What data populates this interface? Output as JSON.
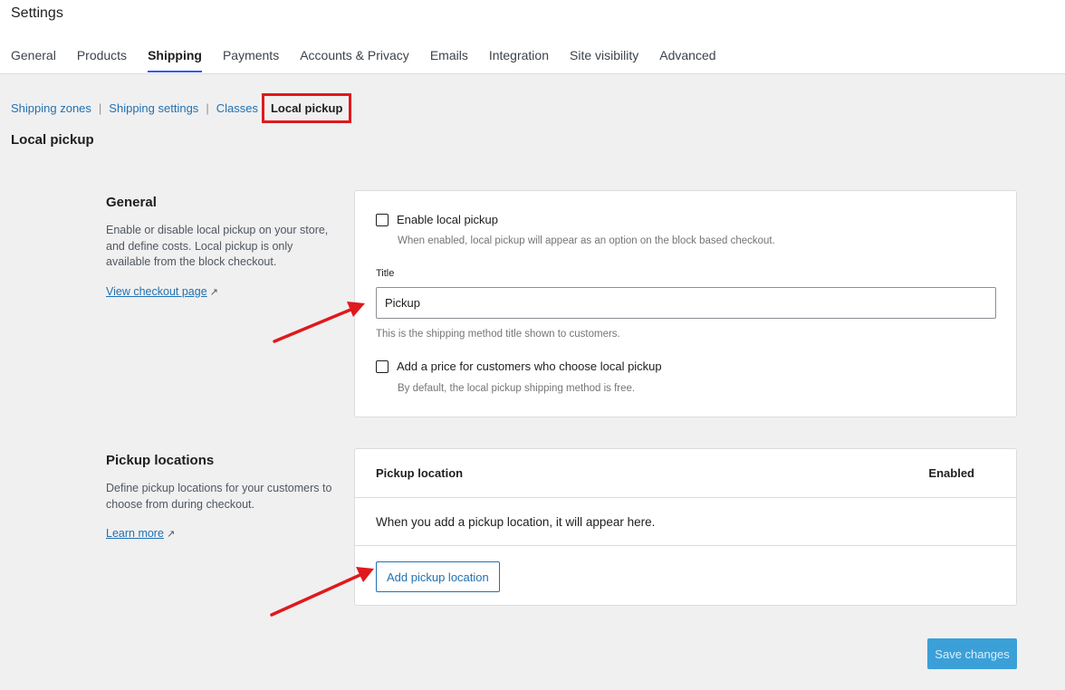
{
  "header": {
    "title": "Settings",
    "tabs": [
      {
        "label": "General"
      },
      {
        "label": "Products"
      },
      {
        "label": "Shipping",
        "active": true
      },
      {
        "label": "Payments"
      },
      {
        "label": "Accounts & Privacy"
      },
      {
        "label": "Emails"
      },
      {
        "label": "Integration"
      },
      {
        "label": "Site visibility"
      },
      {
        "label": "Advanced"
      }
    ]
  },
  "subnav": {
    "items": [
      "Shipping zones",
      "Shipping settings",
      "Classes"
    ],
    "separator": "|",
    "current": "Local pickup"
  },
  "section_title": "Local pickup",
  "general": {
    "heading": "General",
    "description": "Enable or disable local pickup on your store, and define costs. Local pickup is only available from the block checkout.",
    "link": "View checkout page",
    "link_icon": "↗",
    "enable": {
      "label": "Enable local pickup",
      "help": "When enabled, local pickup will appear as an option on the block based checkout."
    },
    "title_field": {
      "label": "Title",
      "value": "Pickup",
      "help": "This is the shipping method title shown to customers."
    },
    "price": {
      "label": "Add a price for customers who choose local pickup",
      "help": "By default, the local pickup shipping method is free."
    }
  },
  "pickup_locations": {
    "heading": "Pickup locations",
    "description": "Define pickup locations for your customers to choose from during checkout.",
    "link": "Learn more",
    "link_icon": "↗",
    "table": {
      "col_location": "Pickup location",
      "col_enabled": "Enabled",
      "empty": "When you add a pickup location, it will appear here."
    },
    "add_button": "Add pickup location"
  },
  "save_button": "Save changes",
  "colors": {
    "accent": "#2271b1",
    "highlight": "#e0191c",
    "save": "#3ba0d8"
  }
}
